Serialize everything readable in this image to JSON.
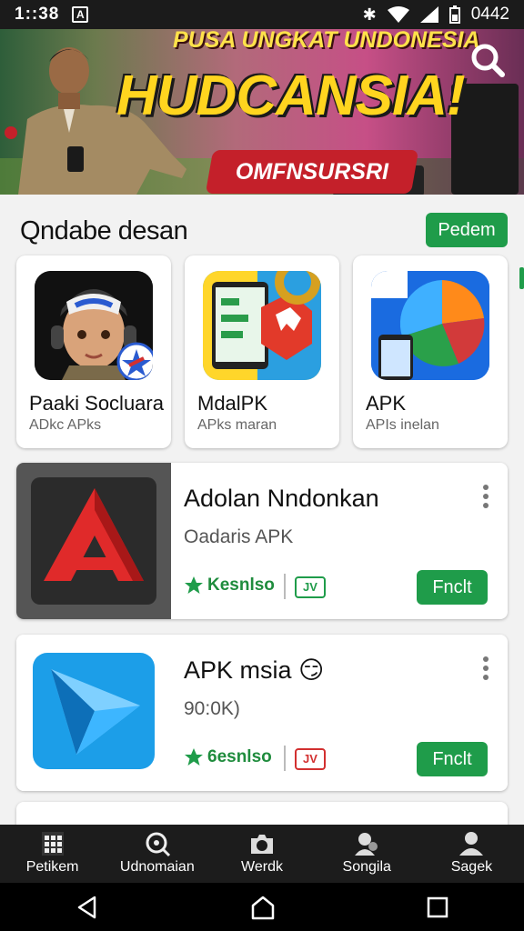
{
  "status_bar": {
    "time": "1::38",
    "notif": "A",
    "battery": "0442"
  },
  "banner": {
    "line1": "PUSA UNGKAT UNDONESIA",
    "line2": "HUDCANSIA!",
    "pill": "OMFNSURSRI"
  },
  "section": {
    "title": "Qndabe desan",
    "action": "Pedem"
  },
  "cards": [
    {
      "title": "Paaki Socluara",
      "subtitle": "ADkc APks"
    },
    {
      "title": "MdalPK",
      "subtitle": "APks maran"
    },
    {
      "title": "APK",
      "subtitle": "APIs inelan"
    }
  ],
  "rows": [
    {
      "name": "Adolan Nndonkan",
      "sub": "Oadaris APK",
      "rating": "Kesnlso",
      "badge": "JV",
      "button": "Fnclt"
    },
    {
      "name": "APK msia",
      "emoji": "😏",
      "sub": "90:0K)",
      "rating": "6esnlso",
      "badge": "JV",
      "button": "Fnclt"
    }
  ],
  "bottom_nav": [
    {
      "label": "Petikem",
      "icon": "grid-icon"
    },
    {
      "label": "Udnomaian",
      "icon": "search-icon"
    },
    {
      "label": "Werdk",
      "icon": "camera-icon"
    },
    {
      "label": "Songila",
      "icon": "people-icon"
    },
    {
      "label": "Sagek",
      "icon": "person-icon"
    }
  ],
  "colors": {
    "accent": "#1f9c4a",
    "banner_pill": "#c4202a",
    "banner_text": "#ffd51f"
  }
}
